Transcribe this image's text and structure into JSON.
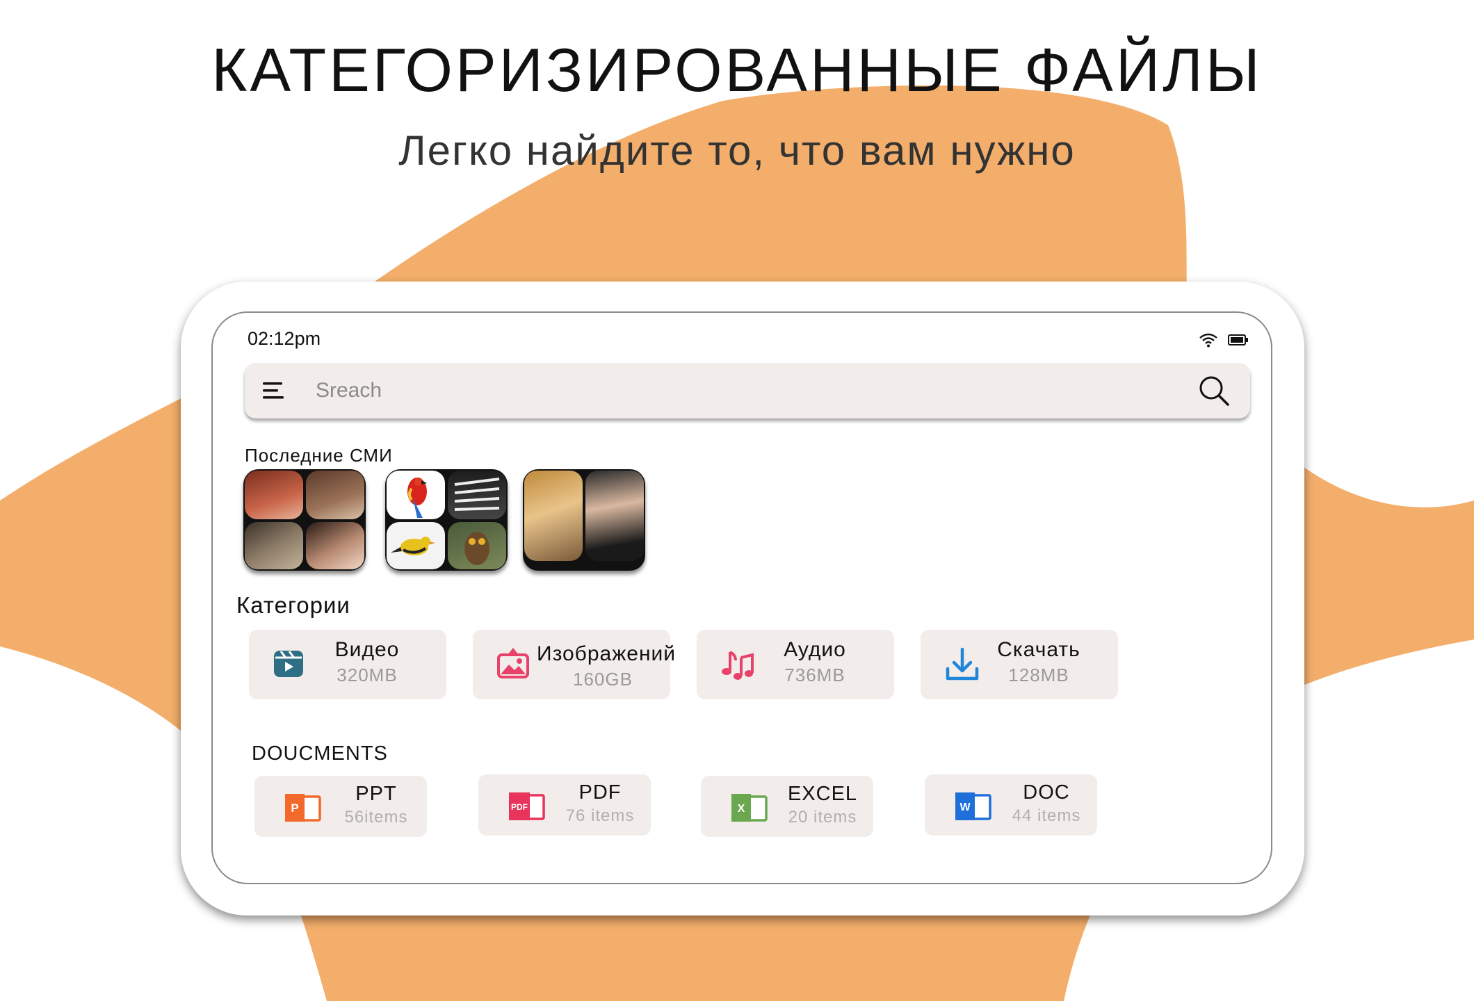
{
  "promo": {
    "title": "КАТЕГОРИЗИРОВАННЫЕ ФАЙЛЫ",
    "subtitle": "Легко найдите то, что вам нужно",
    "accent_color": "#f3ae6b"
  },
  "status_bar": {
    "time": "02:12pm",
    "icons": [
      "wifi-icon",
      "battery-icon"
    ]
  },
  "search": {
    "placeholder": "Sreach",
    "menu_icon": "menu-icon",
    "search_icon": "search-icon"
  },
  "recent_media": {
    "label": "Последние СМИ",
    "albums": [
      "people-collage-1",
      "birds-collage",
      "people-collage-2"
    ]
  },
  "categories": {
    "label": "Категории",
    "items": [
      {
        "name": "Видео",
        "size": "320MB",
        "icon": "video-icon",
        "color": "#2f6f86"
      },
      {
        "name": "Изображений",
        "size": "160GB",
        "icon": "image-icon",
        "color": "#e8416a"
      },
      {
        "name": "Аудио",
        "size": "736MB",
        "icon": "music-icon",
        "color": "#e8416a"
      },
      {
        "name": "Скачать",
        "size": "128MB",
        "icon": "download-icon",
        "color": "#1f86d9"
      }
    ]
  },
  "documents": {
    "label": "DOUCMENTS",
    "items": [
      {
        "name": "PPT",
        "count": "56items",
        "icon": "ppt-icon",
        "badge": "P",
        "color": "#f26a2b"
      },
      {
        "name": "PDF",
        "count": "76 items",
        "icon": "pdf-icon",
        "badge": "PDF",
        "color": "#e8335a"
      },
      {
        "name": "EXCEL",
        "count": "20 items",
        "icon": "excel-icon",
        "badge": "X",
        "color": "#6aa84f"
      },
      {
        "name": "DOC",
        "count": "44 items",
        "icon": "doc-icon",
        "badge": "W",
        "color": "#1f6fd9"
      }
    ]
  }
}
